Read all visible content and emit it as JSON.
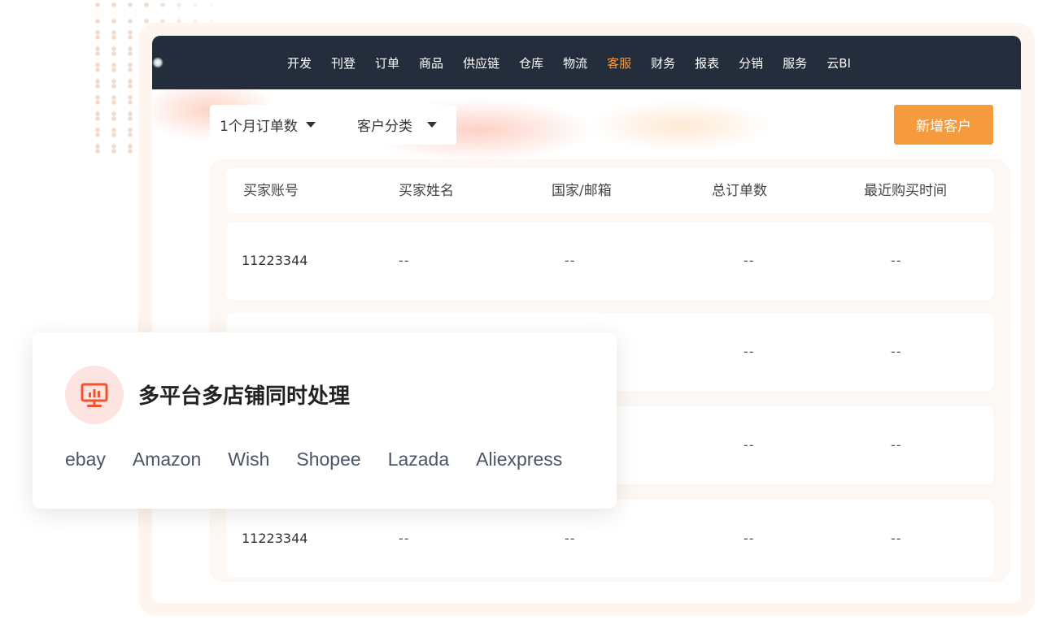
{
  "nav": {
    "items": [
      {
        "label": "开发",
        "active": false
      },
      {
        "label": "刊登",
        "active": false
      },
      {
        "label": "订单",
        "active": false
      },
      {
        "label": "商品",
        "active": false
      },
      {
        "label": "供应链",
        "active": false
      },
      {
        "label": "仓库",
        "active": false
      },
      {
        "label": "物流",
        "active": false
      },
      {
        "label": "客服",
        "active": true
      },
      {
        "label": "财务",
        "active": false
      },
      {
        "label": "报表",
        "active": false
      },
      {
        "label": "分销",
        "active": false
      },
      {
        "label": "服务",
        "active": false
      },
      {
        "label": "云BI",
        "active": false
      }
    ],
    "active_color": "#f39a3d",
    "background": "#242d3c"
  },
  "toolbar": {
    "orders_filter_label": "1个月订单数",
    "category_filter_label": "客户分类",
    "add_customer_label": "新增客户",
    "accent": "#f59a3d"
  },
  "table": {
    "headers": [
      "买家账号",
      "买家姓名",
      "国家/邮箱",
      "总订单数",
      "最近购买时间"
    ],
    "rows": [
      [
        "11223344",
        "--",
        "--",
        "--",
        "--"
      ],
      [
        "",
        "",
        "",
        "--",
        "--"
      ],
      [
        "",
        "",
        "",
        "--",
        "--"
      ],
      [
        "11223344",
        "--",
        "--",
        "--",
        "--"
      ]
    ]
  },
  "feature_card": {
    "icon": "monitor-chart-icon",
    "icon_color": "#f2522e",
    "title": "多平台多店铺同时处理",
    "platforms": [
      "ebay",
      "Amazon",
      "Wish",
      "Shopee",
      "Lazada",
      "Aliexpress"
    ]
  }
}
